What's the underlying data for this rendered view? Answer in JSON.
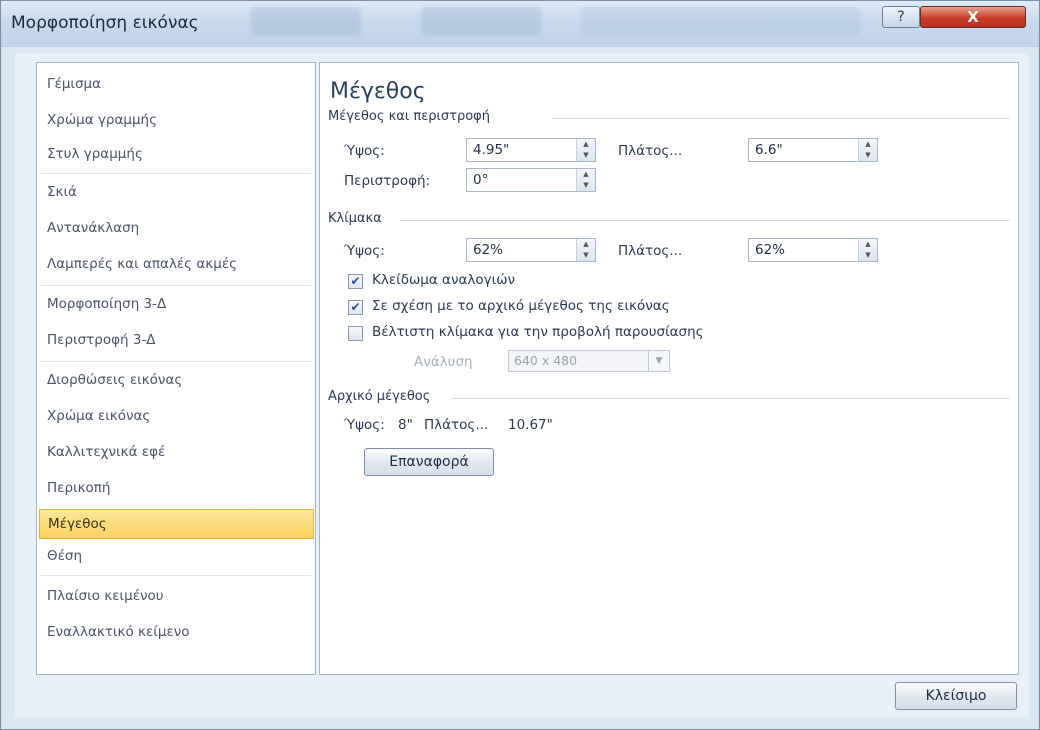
{
  "window": {
    "title": "Μορφοποίηση εικόνας",
    "help_label": "?",
    "close_label": "X"
  },
  "nav": {
    "items": [
      {
        "label": "Γέμισμα"
      },
      {
        "label": "Χρώμα γραμμής"
      },
      {
        "label": "Στυλ γραμμής"
      },
      {
        "label": "Σκιά"
      },
      {
        "label": "Αντανάκλαση"
      },
      {
        "label": "Λαμπερές και απαλές ακμές"
      },
      {
        "label": "Μορφοποίηση 3-Δ"
      },
      {
        "label": "Περιστροφή 3-Δ"
      },
      {
        "label": "Διορθώσεις εικόνας"
      },
      {
        "label": "Χρώμα εικόνας"
      },
      {
        "label": "Καλλιτεχνικά εφέ"
      },
      {
        "label": "Περικοπή"
      },
      {
        "label": "Μέγεθος"
      },
      {
        "label": "Θέση"
      },
      {
        "label": "Πλαίσιο κειμένου"
      },
      {
        "label": "Εναλλακτικό κείμενο"
      }
    ],
    "selected": "Μέγεθος"
  },
  "panel": {
    "title": "Μέγεθος",
    "size_rotate": {
      "heading": "Μέγεθος και περιστροφή",
      "height_label": "Ύψος:",
      "height_value": "4.95\"",
      "width_label": "Πλάτος...",
      "width_value": "6.6\"",
      "rotation_label": "Περιστροφή:",
      "rotation_value": "0°"
    },
    "scale": {
      "heading": "Κλίμακα",
      "height_label": "Ύψος:",
      "height_value": "62%",
      "width_label": "Πλάτος...",
      "width_value": "62%",
      "lock_aspect_label": "Κλείδωμα αναλογιών",
      "lock_aspect_checked": true,
      "relative_label": "Σε σχέση με το αρχικό μέγεθος της εικόνας",
      "relative_checked": true,
      "best_scale_label": "Βέλτιστη κλίμακα για την προβολή παρουσίασης",
      "best_scale_checked": false,
      "resolution_label": "Ανάλυση",
      "resolution_value": "640 x 480"
    },
    "original": {
      "heading": "Αρχικό μέγεθος",
      "height_label": "Ύψος:",
      "height_value": "8\"",
      "width_label": "Πλάτος...",
      "width_value": "10.67\"",
      "reset_label": "Επαναφορά"
    }
  },
  "footer": {
    "close_label": "Κλείσιμο"
  },
  "colors": {
    "selected_bg": "#f9d25e",
    "accent_text": "#2b3f5e",
    "close_red": "#c9402a"
  }
}
